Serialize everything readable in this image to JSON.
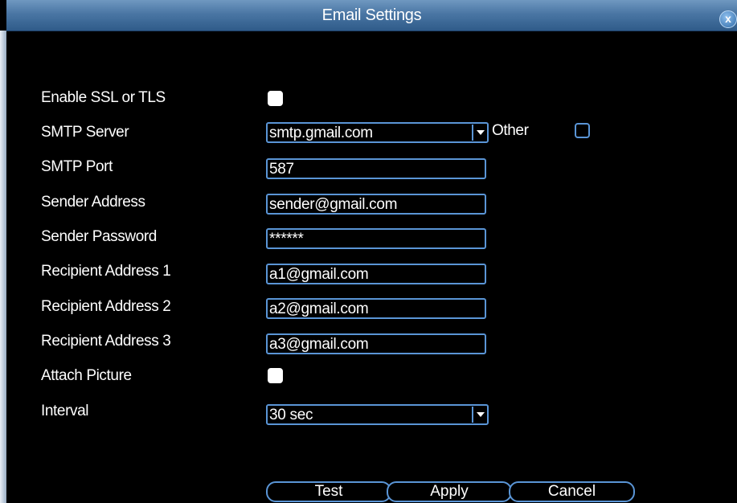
{
  "window": {
    "title": "Email Settings",
    "close_label": "x"
  },
  "labels": {
    "ssl": "Enable SSL or TLS",
    "smtp_server": "SMTP Server",
    "smtp_port": "SMTP Port",
    "sender_address": "Sender Address",
    "sender_password": "Sender Password",
    "recipient_1": "Recipient Address 1",
    "recipient_2": "Recipient Address 2",
    "recipient_3": "Recipient Address 3",
    "attach_picture": "Attach Picture",
    "interval": "Interval",
    "other": "Other"
  },
  "values": {
    "ssl_checked": false,
    "smtp_server": "smtp.gmail.com",
    "other_checked": false,
    "smtp_port": "587",
    "sender_address": "sender@gmail.com",
    "sender_password": "******",
    "recipient_1": "a1@gmail.com",
    "recipient_2": "a2@gmail.com",
    "recipient_3": "a3@gmail.com",
    "attach_picture_checked": false,
    "interval": "30 sec"
  },
  "buttons": {
    "test": "Test",
    "apply": "Apply",
    "cancel": "Cancel"
  },
  "colors": {
    "accent": "#5a95d6",
    "titlebar": "#4a76a4",
    "background": "#000000"
  }
}
